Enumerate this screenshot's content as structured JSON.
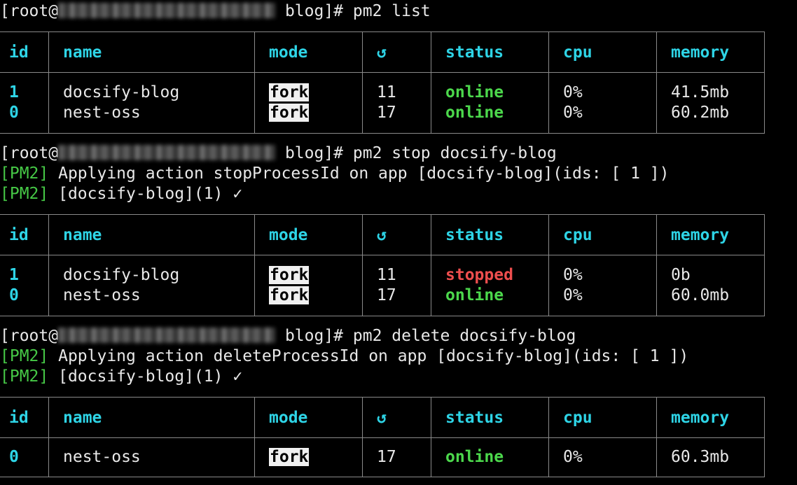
{
  "colors": {
    "background": "#000000",
    "text": "#e8e8e8",
    "header_cyan": "#2ed4e6",
    "pm2_tag_green": "#46c846",
    "status_online": "#4cd84c",
    "status_stopped": "#ee4e4e",
    "mode_badge_bg": "#f0f0f0"
  },
  "table_headers": [
    "id",
    "name",
    "mode",
    "↺",
    "status",
    "cpu",
    "memory"
  ],
  "commands": [
    {
      "prompt_prefix": "[root@",
      "prompt_suffix": " blog]#",
      "command": " pm2 list"
    },
    {
      "prompt_prefix": "[root@",
      "prompt_suffix": " blog]#",
      "command": " pm2 stop docsify-blog"
    },
    {
      "prompt_prefix": "[root@",
      "prompt_suffix": " blog]#",
      "command": " pm2 delete docsify-blog"
    }
  ],
  "outputs": {
    "stop": [
      {
        "tag": "[PM2]",
        "text": " Applying action stopProcessId on app [docsify-blog](ids: [ 1 ])"
      },
      {
        "tag": "[PM2]",
        "text": " [docsify-blog](1) ✓"
      }
    ],
    "delete": [
      {
        "tag": "[PM2]",
        "text": " Applying action deleteProcessId on app [docsify-blog](ids: [ 1 ])"
      },
      {
        "tag": "[PM2]",
        "text": " [docsify-blog](1) ✓"
      }
    ]
  },
  "tables": [
    {
      "rows": [
        {
          "id": "1",
          "name": "docsify-blog",
          "mode": "fork",
          "restarts": "11",
          "status": "online",
          "cpu": "0%",
          "memory": "41.5mb"
        },
        {
          "id": "0",
          "name": "nest-oss",
          "mode": "fork",
          "restarts": "17",
          "status": "online",
          "cpu": "0%",
          "memory": "60.2mb"
        }
      ]
    },
    {
      "rows": [
        {
          "id": "1",
          "name": "docsify-blog",
          "mode": "fork",
          "restarts": "11",
          "status": "stopped",
          "cpu": "0%",
          "memory": "0b"
        },
        {
          "id": "0",
          "name": "nest-oss",
          "mode": "fork",
          "restarts": "17",
          "status": "online",
          "cpu": "0%",
          "memory": "60.0mb"
        }
      ]
    },
    {
      "rows": [
        {
          "id": "0",
          "name": "nest-oss",
          "mode": "fork",
          "restarts": "17",
          "status": "online",
          "cpu": "0%",
          "memory": "60.3mb"
        }
      ]
    }
  ]
}
